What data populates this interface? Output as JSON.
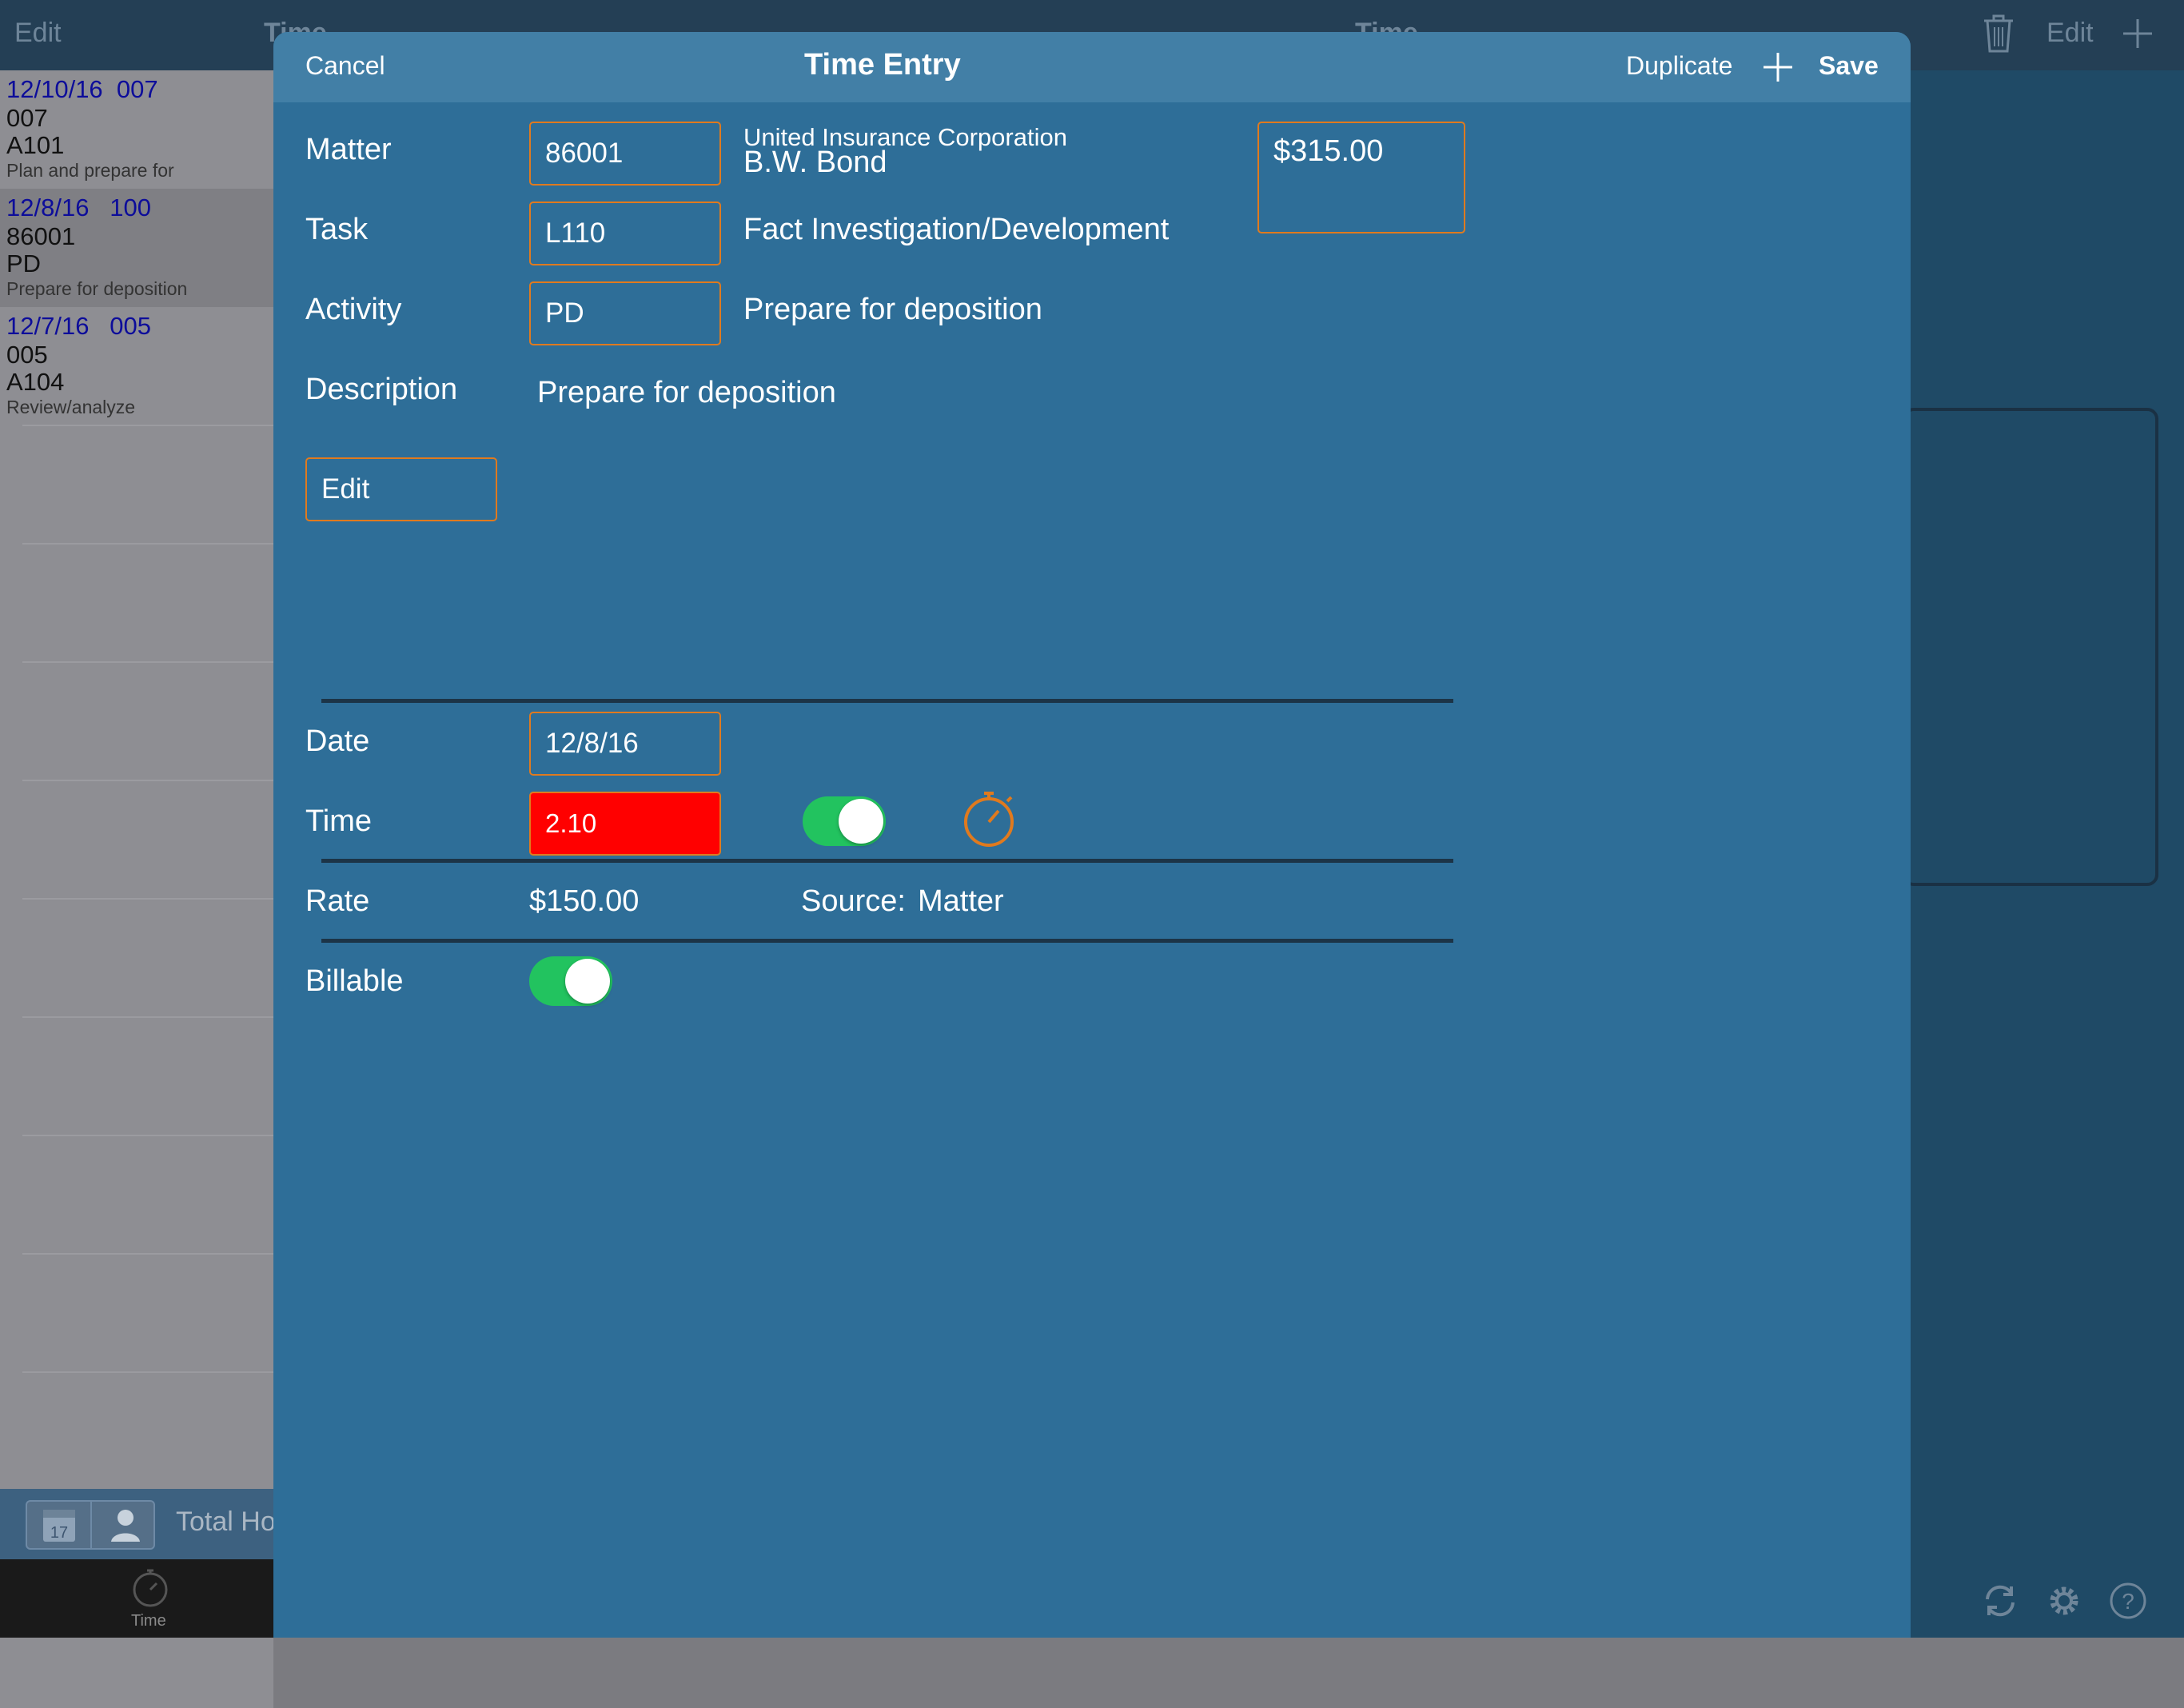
{
  "background": {
    "left_header": {
      "edit_label": "Edit",
      "title": "Time"
    },
    "right_header": {
      "title": "Time",
      "edit_label": "Edit"
    },
    "list": [
      {
        "date": "12/10/16",
        "code": "007",
        "matter": "007",
        "activity": "A101",
        "desc": "Plan and prepare for"
      },
      {
        "date": "12/8/16",
        "code": "100",
        "matter": "86001",
        "activity": "PD",
        "desc": "Prepare for deposition"
      },
      {
        "date": "12/7/16",
        "code": "005",
        "matter": "005",
        "activity": "A104",
        "desc": "Review/analyze"
      }
    ],
    "bottom_bar": {
      "calendar_day": "17",
      "total_label": "Total Ho"
    },
    "tabbar": {
      "time_label": "Time"
    }
  },
  "modal": {
    "header": {
      "cancel": "Cancel",
      "title": "Time Entry",
      "duplicate": "Duplicate",
      "save": "Save"
    },
    "matter": {
      "label": "Matter",
      "value": "86001",
      "client": "United Insurance Corporation",
      "name": "B.W. Bond"
    },
    "amount": "$315.00",
    "task": {
      "label": "Task",
      "value": "L110",
      "description": "Fact Investigation/Development"
    },
    "activity": {
      "label": "Activity",
      "value": "PD",
      "description": "Prepare for deposition"
    },
    "description": {
      "label": "Description",
      "value": "Prepare for deposition"
    },
    "edit_button": "Edit",
    "date": {
      "label": "Date",
      "value": "12/8/16"
    },
    "time": {
      "label": "Time",
      "value": "2.10",
      "timer_on": true
    },
    "rate": {
      "label": "Rate",
      "value": "$150.00",
      "source_label": "Source:",
      "source_value": "Matter"
    },
    "billable": {
      "label": "Billable",
      "on": true
    }
  },
  "colors": {
    "modal_bg": "#2e6e98",
    "header_bg": "#427fa6",
    "field_border": "#e07a1e",
    "time_field_bg": "#ff0000",
    "switch_on": "#22c35f",
    "list_date": "#0d0d9a"
  }
}
